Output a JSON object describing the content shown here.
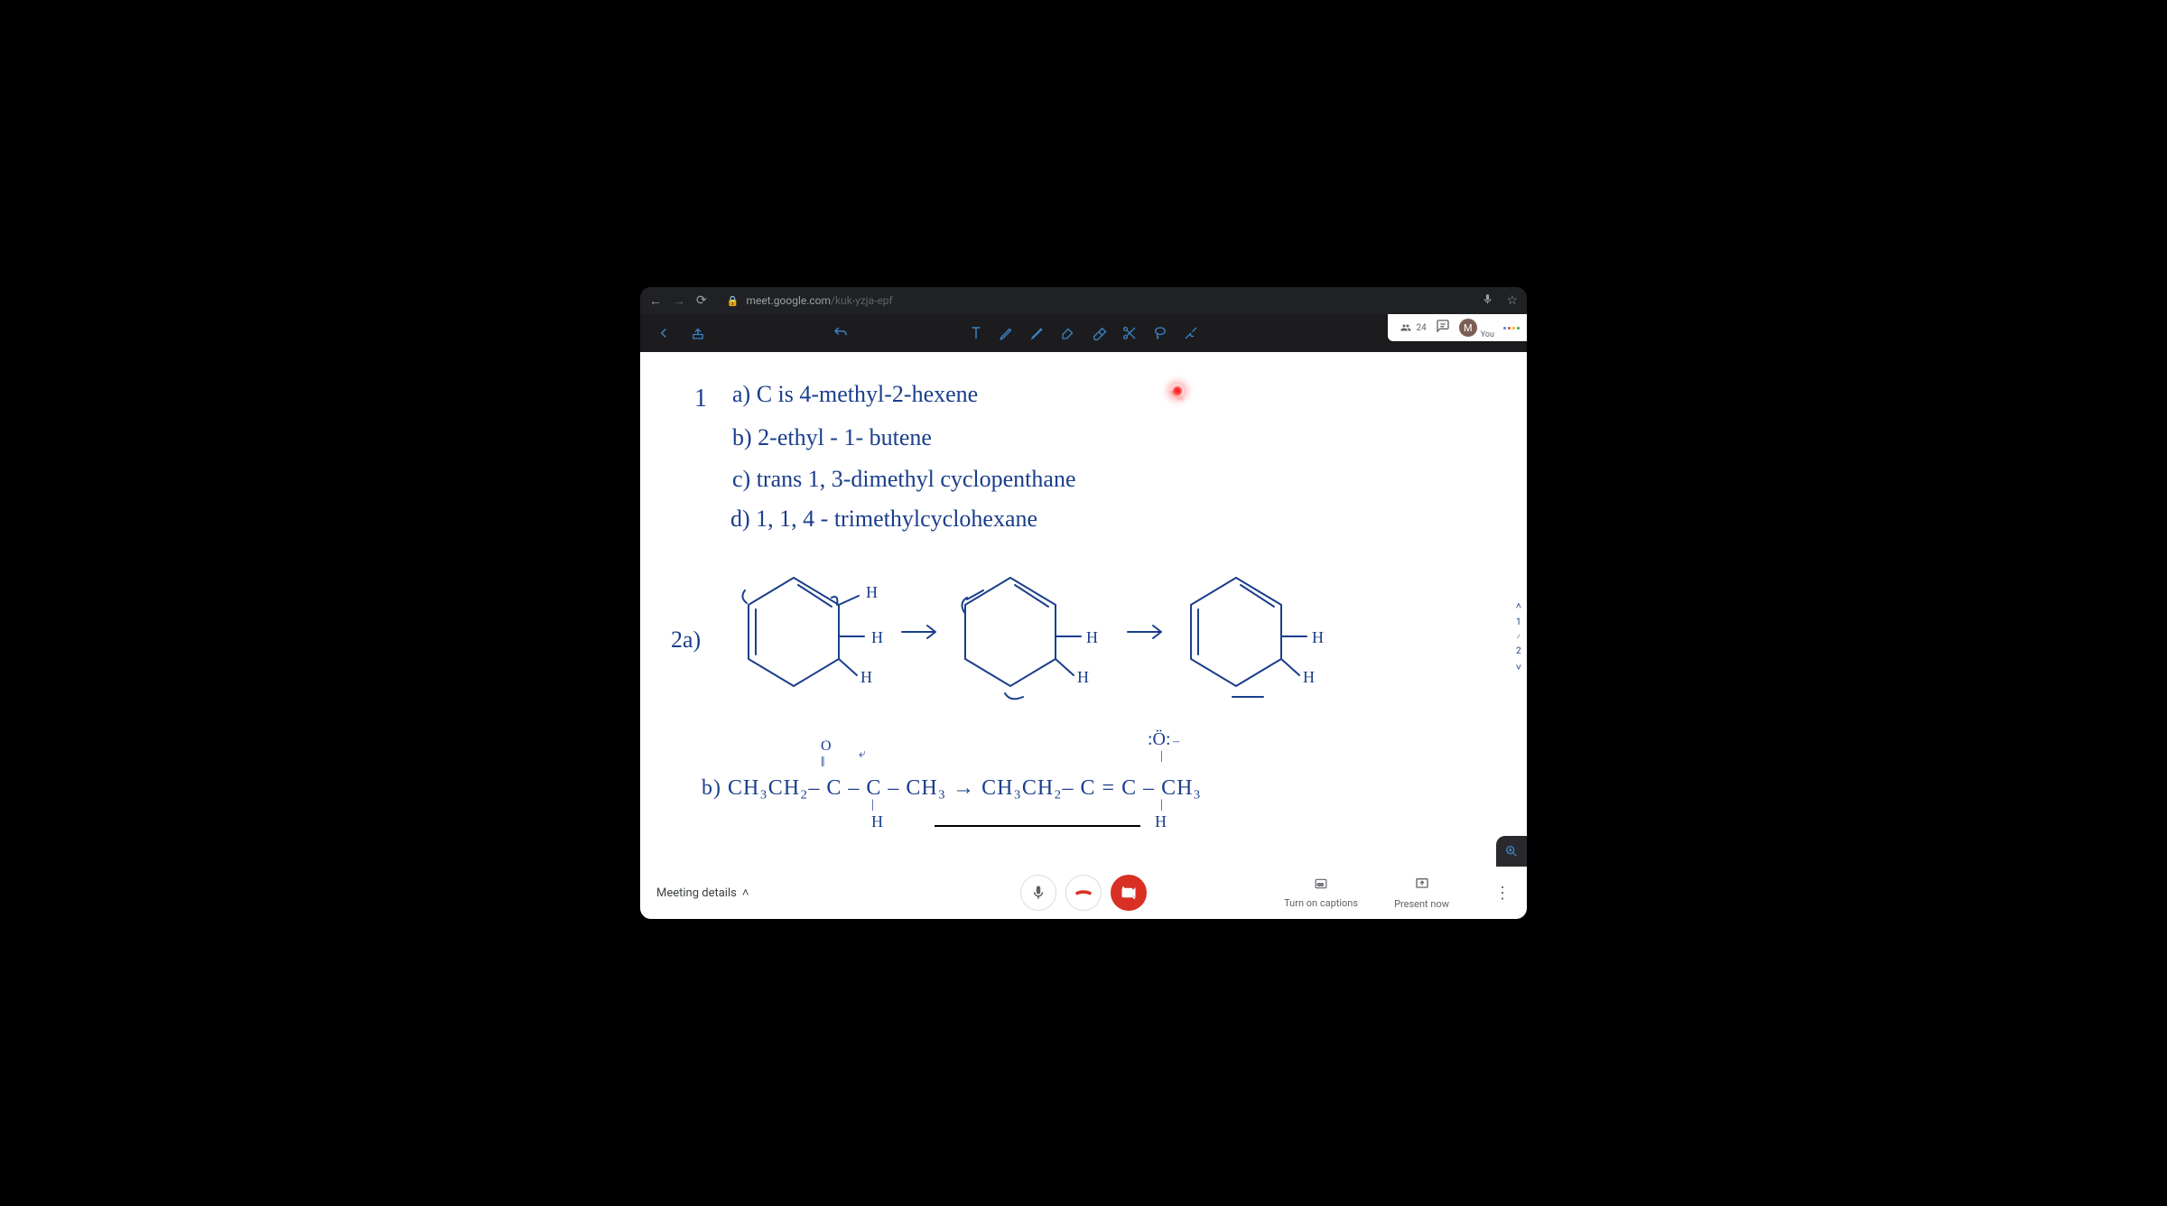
{
  "browser": {
    "url_host": "meet.google.com",
    "url_path": "/kuk-yzja-epf"
  },
  "meet_header": {
    "participant_count": "24",
    "avatar_initial": "M",
    "you_label": "You"
  },
  "page_nav": {
    "page1": "1",
    "page2": "2"
  },
  "notes": {
    "q1_num": "1",
    "q1a": "a)  C  is  4-methyl-2-hexene",
    "q1b": "b) 2-ethyl - 1- butene",
    "q1c": "c) trans 1, 3-dimethyl cyclopenthane",
    "q1d": "d)  1, 1, 4 - trimethylcyclohexane",
    "q2_label": "2a)",
    "h1": "H",
    "h2": "H",
    "h3": "H",
    "h4": "H",
    "h5": "H",
    "h6": "H",
    "h7": "H",
    "arrow": "→",
    "q2b_left": "b)  CH₃CH₂– C – C – CH₃ →  CH₃CH₂– C = C – CH₃",
    "o_label": "O",
    "o_neg": ":Ö:",
    "h_bottom1": "H",
    "h_bottom2": "H"
  },
  "bottom_bar": {
    "meeting_details": "Meeting details",
    "captions": "Turn on captions",
    "present": "Present now"
  }
}
